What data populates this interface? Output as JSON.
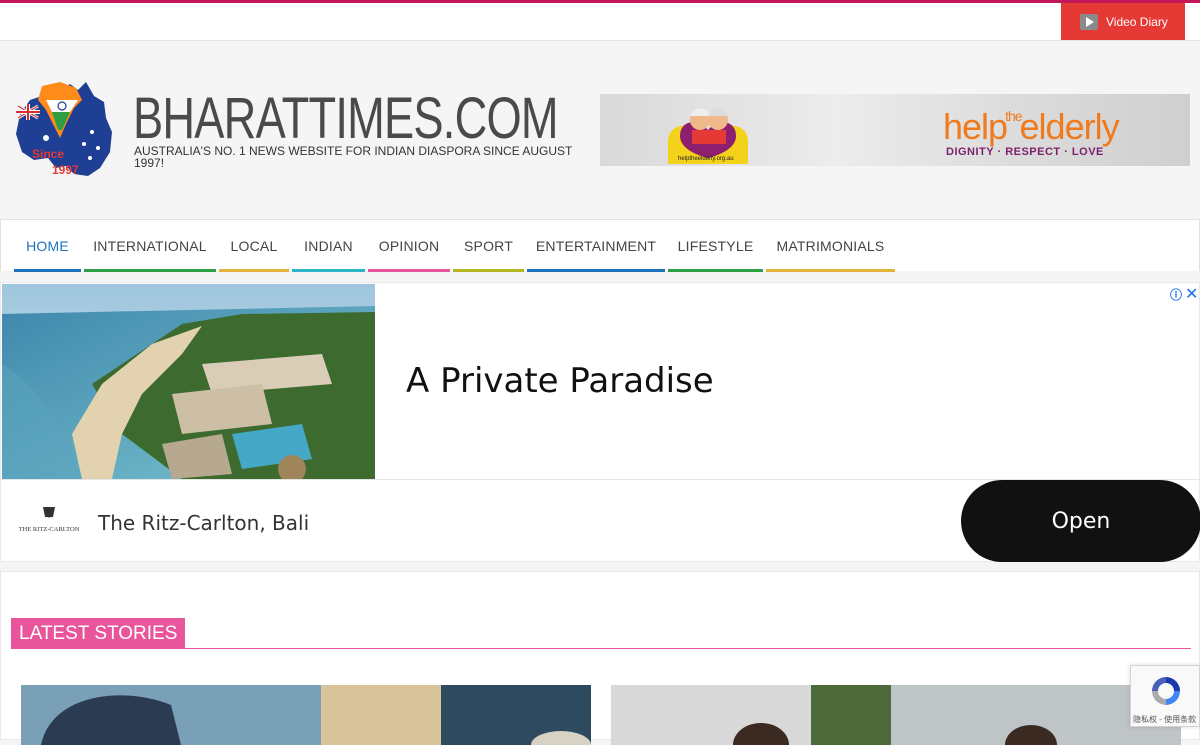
{
  "topbar": {
    "video_label": "Video Diary"
  },
  "header": {
    "logo_text_since": "Since",
    "logo_text_year": "1997",
    "site_title": "BHARATTIMES.COM",
    "tagline": "AUSTRALIA'S NO. 1 NEWS WEBSITE FOR INDIAN DIASPORA SINCE AUGUST 1997!",
    "banner": {
      "site": "helptheelderly.org.au",
      "brand_help": "help",
      "brand_the": "the",
      "brand_elderly": "elderly",
      "motto": "DIGNITY · RESPECT · LOVE"
    }
  },
  "nav": {
    "items": [
      {
        "label": "HOME",
        "color": "#1e73be"
      },
      {
        "label": "INTERNATIONAL",
        "color": "#2e9e44"
      },
      {
        "label": "LOCAL",
        "color": "#e2b23a"
      },
      {
        "label": "INDIAN",
        "color": "#2bb5c7"
      },
      {
        "label": "OPINION",
        "color": "#e8559a"
      },
      {
        "label": "SPORT",
        "color": "#b5b51f"
      },
      {
        "label": "ENTERTAINMENT",
        "color": "#1e73be"
      },
      {
        "label": "LIFESTYLE",
        "color": "#2e9e44"
      },
      {
        "label": "MATRIMONIALS",
        "color": "#e2b23a"
      }
    ]
  },
  "ad": {
    "headline": "A Private Paradise",
    "brand_logo_text": "THE RITZ-CARLTON",
    "brand": "The Ritz-Carlton, Bali",
    "cta": "Open",
    "info_icon": "info-icon",
    "close_icon": "close-icon"
  },
  "latest": {
    "title": "LATEST STORIES"
  },
  "recaptcha": {
    "text": "隐私权 - 使用条款"
  }
}
